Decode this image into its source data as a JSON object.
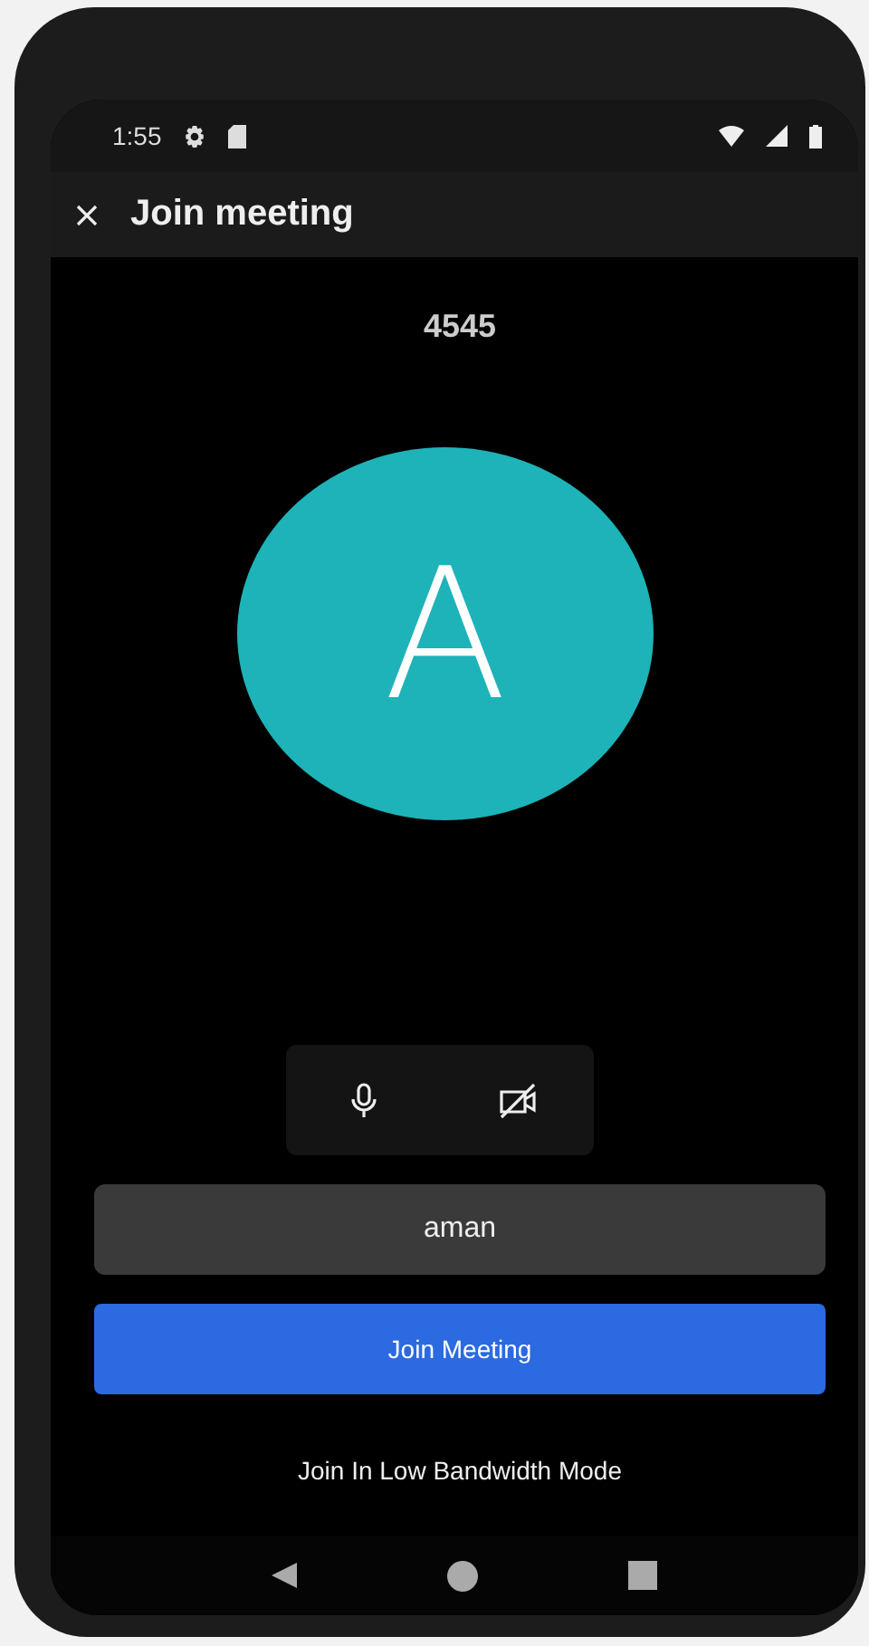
{
  "status_bar": {
    "time": "1:55"
  },
  "app_bar": {
    "title": "Join meeting"
  },
  "meeting_id": "4545",
  "avatar": {
    "initial": "A",
    "color": "#1eb3b8"
  },
  "controls": [
    {
      "kind": "mic",
      "off": false
    },
    {
      "kind": "camera",
      "off": true
    }
  ],
  "name_field": {
    "value": "aman"
  },
  "join_button": {
    "label": "Join Meeting"
  },
  "low_bandwidth_link": {
    "label": "Join In Low Bandwidth Mode"
  }
}
